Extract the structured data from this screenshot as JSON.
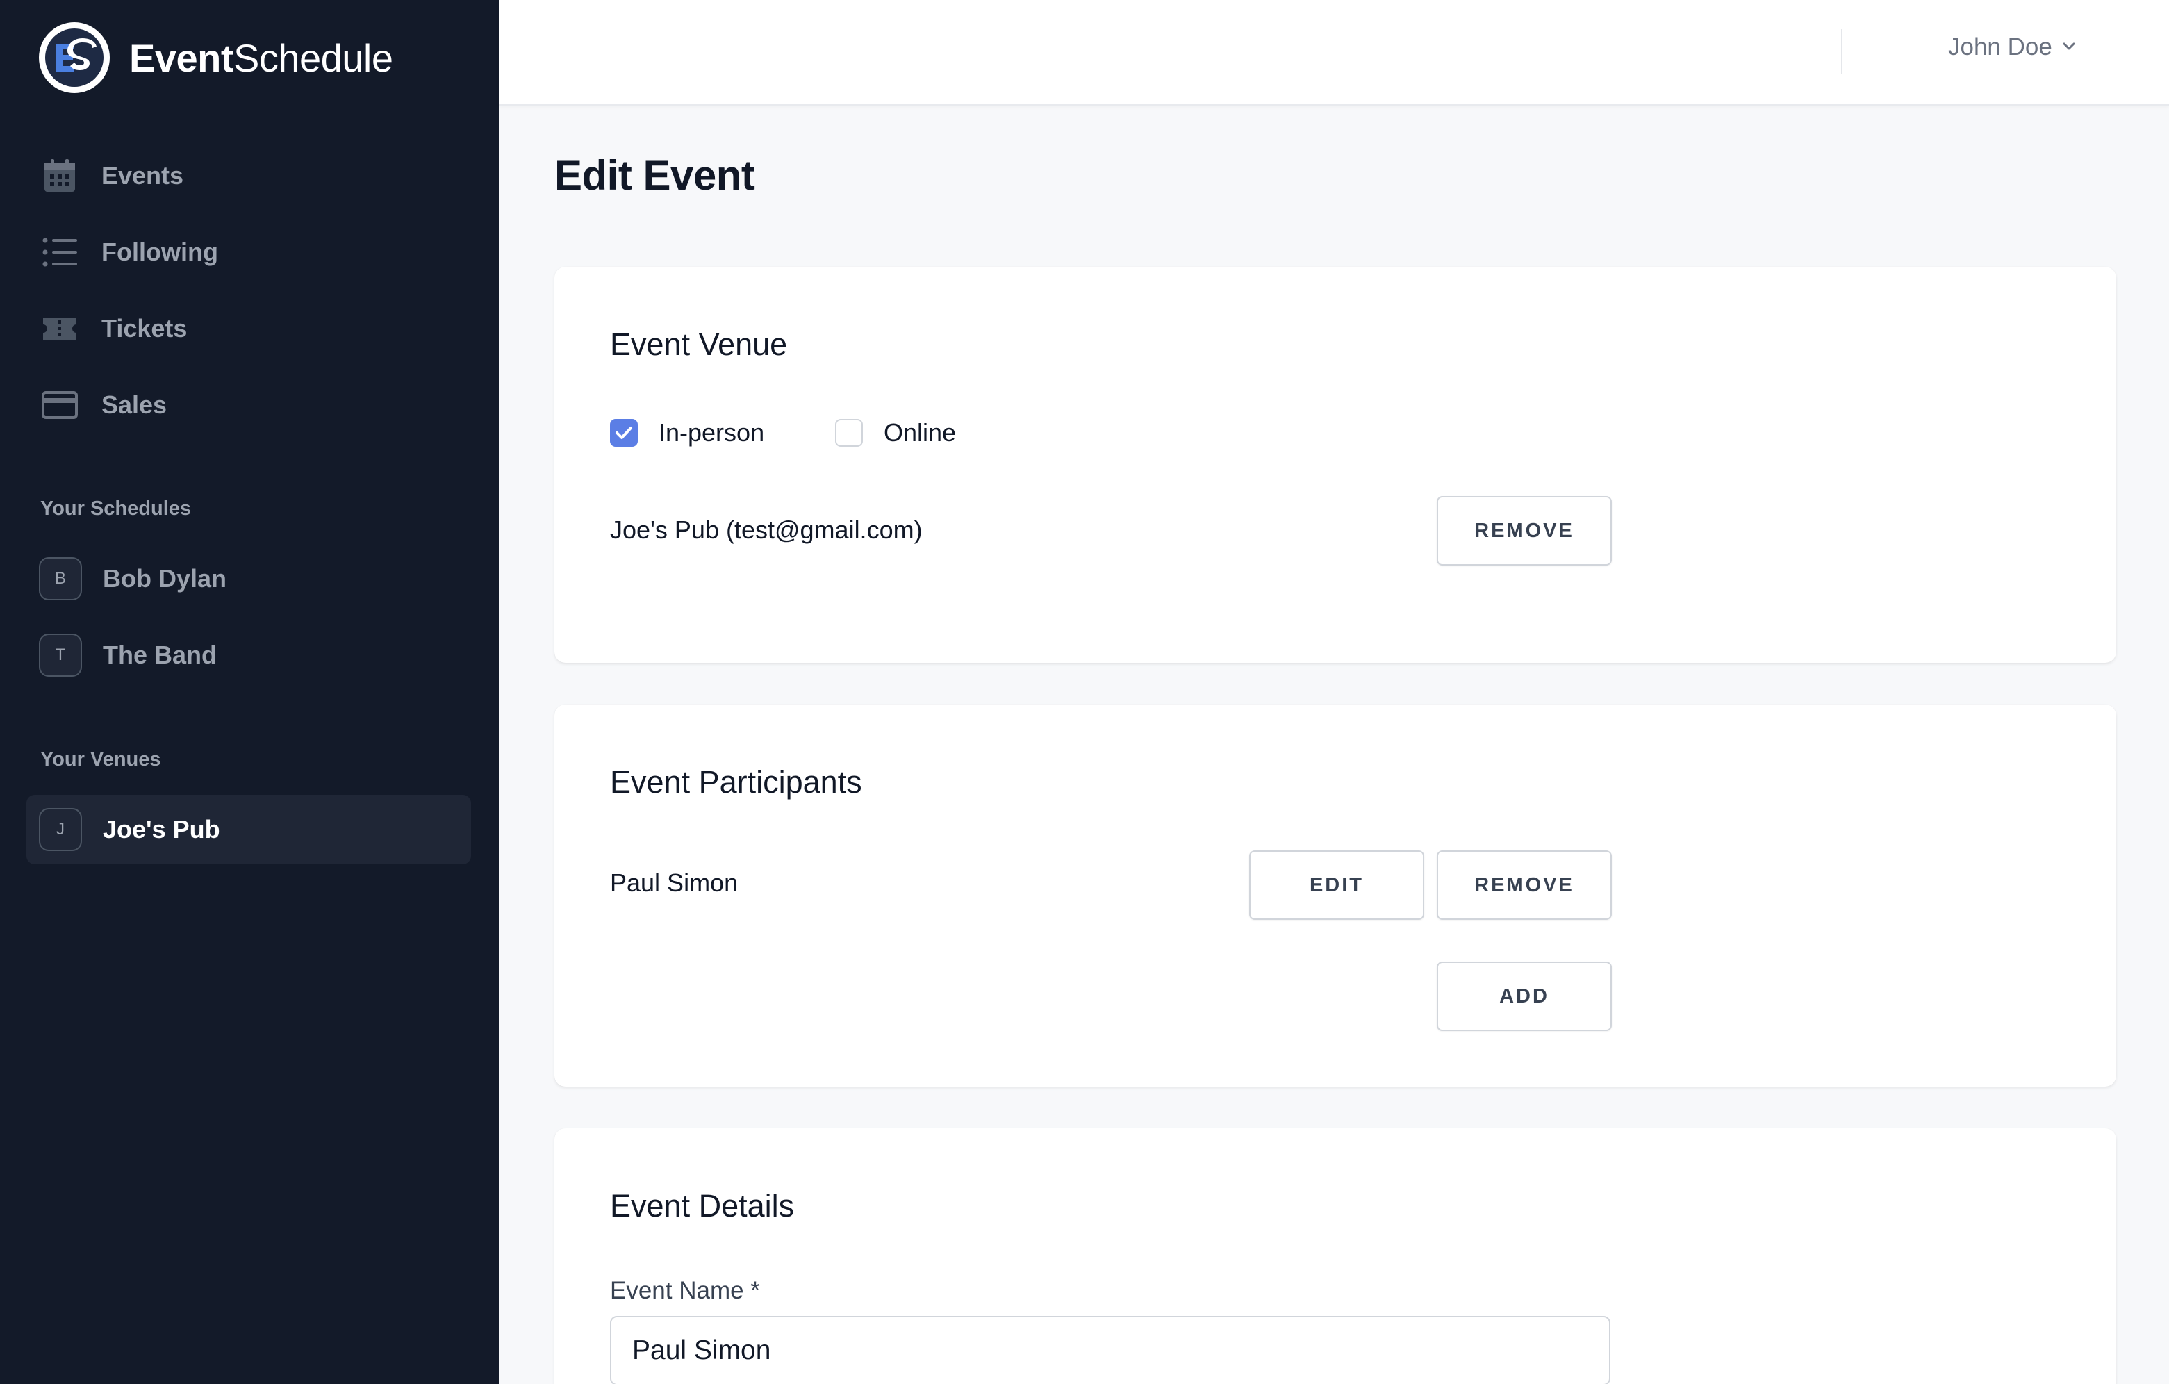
{
  "app": {
    "brand_bold": "Event",
    "brand_rest": "Schedule",
    "logo_letters": "ES"
  },
  "sidebar": {
    "nav": [
      {
        "label": "Events",
        "icon": "calendar-icon"
      },
      {
        "label": "Following",
        "icon": "list-icon"
      },
      {
        "label": "Tickets",
        "icon": "ticket-icon"
      },
      {
        "label": "Sales",
        "icon": "credit-card-icon"
      }
    ],
    "schedules_heading": "Your Schedules",
    "schedules": [
      {
        "initial": "B",
        "label": "Bob Dylan"
      },
      {
        "initial": "T",
        "label": "The Band"
      }
    ],
    "venues_heading": "Your Venues",
    "venues": [
      {
        "initial": "J",
        "label": "Joe's Pub",
        "active": true
      }
    ]
  },
  "header": {
    "user_name": "John Doe"
  },
  "page": {
    "title": "Edit Event"
  },
  "venue_card": {
    "title": "Event Venue",
    "in_person_label": "In-person",
    "in_person_checked": true,
    "online_label": "Online",
    "online_checked": false,
    "venue_text": "Joe's Pub (test@gmail.com)",
    "remove_label": "REMOVE"
  },
  "participants_card": {
    "title": "Event Participants",
    "participant_name": "Paul Simon",
    "edit_label": "EDIT",
    "remove_label": "REMOVE",
    "add_label": "ADD"
  },
  "details_card": {
    "title": "Event Details",
    "name_label": "Event Name *",
    "name_value": "Paul Simon"
  },
  "colors": {
    "sidebar_bg": "#131a29",
    "accent": "#5b7ee5",
    "page_bg": "#f7f8fa"
  }
}
